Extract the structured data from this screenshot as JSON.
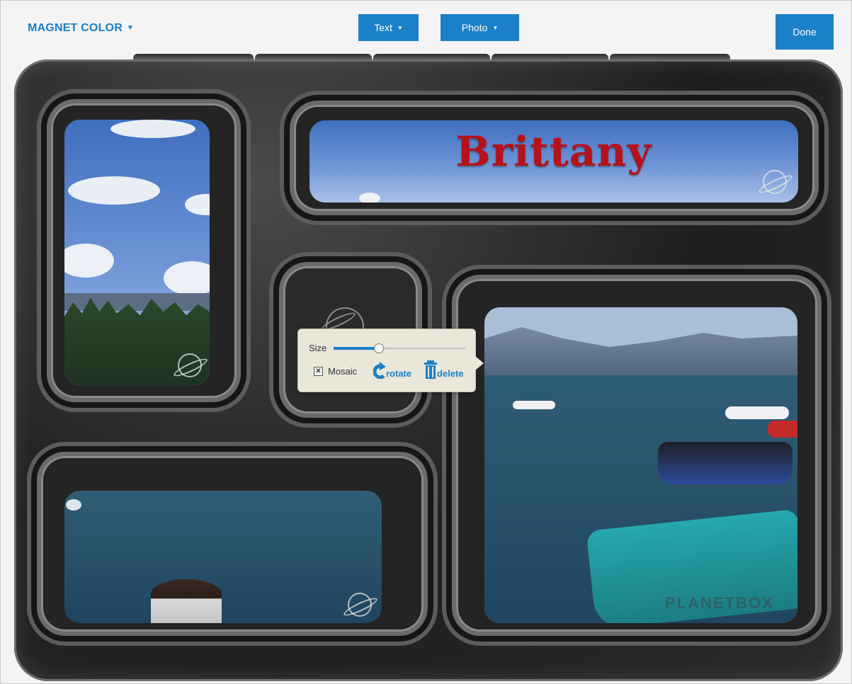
{
  "toolbar": {
    "magnet_color_label": "MAGNET COLOR",
    "magnet_caret": "▼",
    "text_label": "Text",
    "photo_label": "Photo",
    "dropdown_caret": "▼",
    "done_label": "Done"
  },
  "canvas": {
    "name_text": "Brittany",
    "watermark_text": "PLANETBOX"
  },
  "popup": {
    "size_label": "Size",
    "size_value": 0.34,
    "mosaic_label": "Mosaic",
    "mosaic_checked": "✕",
    "rotate_label": "rotate",
    "delete_label": "delete"
  },
  "colors": {
    "accent": "#1a80c8",
    "name_text": "#b5121b",
    "popup_bg": "#e9e6da"
  }
}
